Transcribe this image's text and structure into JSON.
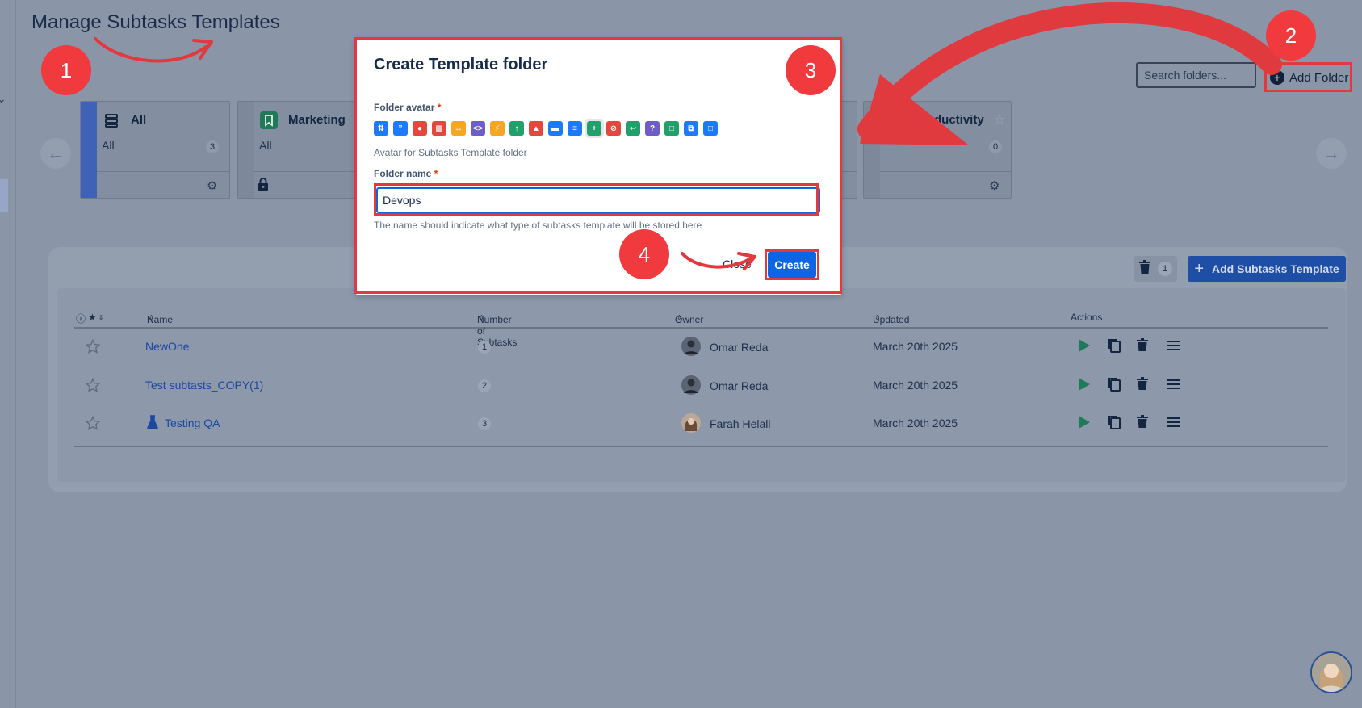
{
  "page": {
    "title": "Manage Subtasks Templates"
  },
  "toolbar": {
    "search_placeholder": "Search folders...",
    "add_folder_label": "Add Folder",
    "add_template_label": "Add Subtasks Template",
    "trash_count": "1"
  },
  "folders": [
    {
      "name": "All",
      "sub": "All",
      "count": "3"
    },
    {
      "name": "Marketing",
      "sub": "All"
    },
    {
      "name": "Productivity",
      "count": "0"
    }
  ],
  "table": {
    "headers": {
      "name": "Name",
      "subtasks": "Number of Subtasks",
      "owner": "Owner",
      "updated": "Updated",
      "actions": "Actions"
    },
    "rows": [
      {
        "name": "NewOne",
        "count": "1",
        "owner": "Omar Reda",
        "updated": "March 20th 2025"
      },
      {
        "name": "Test subtasts_COPY(1)",
        "count": "2",
        "owner": "Omar Reda",
        "updated": "March 20th 2025"
      },
      {
        "name": "Testing QA",
        "count": "3",
        "owner": "Farah Helali",
        "updated": "March 20th 2025"
      }
    ]
  },
  "modal": {
    "title": "Create Template folder",
    "avatar_label": "Folder avatar",
    "avatar_help": "Avatar for Subtasks Template folder",
    "name_label": "Folder name",
    "name_value": "Devops",
    "name_help": "The name should indicate what type of subtasks template will be stored here",
    "close_label": "Close",
    "create_label": "Create",
    "required_mark": "*"
  },
  "annotations": {
    "step1": "1",
    "step2": "2",
    "step3": "3",
    "step4": "4"
  },
  "colors": {
    "annotation_red": "#e03a3f",
    "primary_blue": "#0c66e4",
    "link_blue": "#1c48a0",
    "overlay_bg": "#8a95a8"
  }
}
